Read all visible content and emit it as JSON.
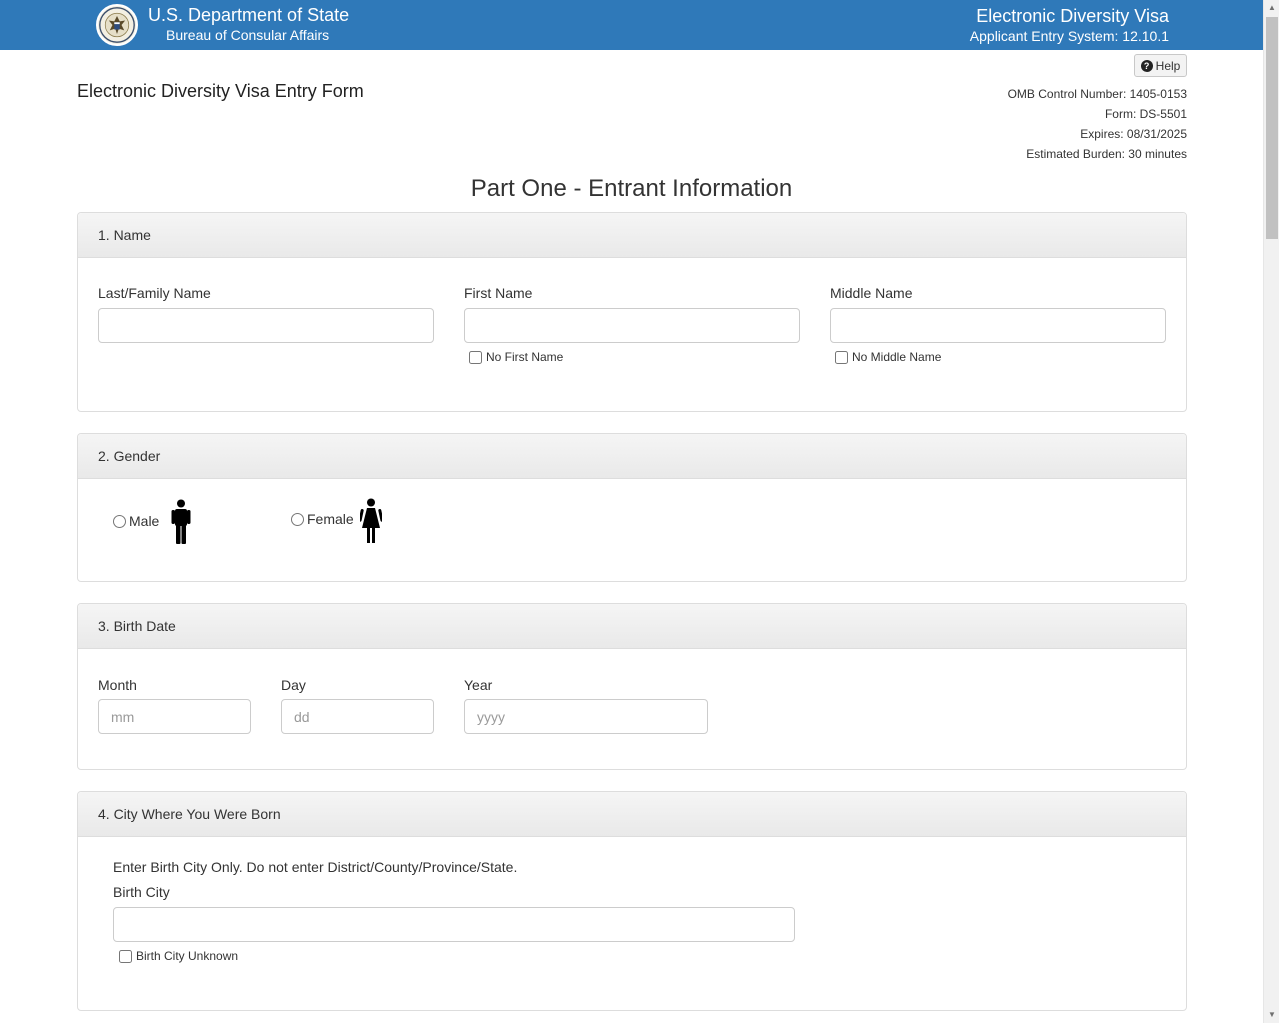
{
  "header": {
    "department": "U.S. Department of State",
    "bureau": "Bureau of Consular Affairs",
    "system_title": "Electronic Diversity Visa",
    "system_version": "Applicant Entry System: 12.10.1"
  },
  "help_label": "Help",
  "form_title": "Electronic Diversity Visa Entry Form",
  "meta": {
    "omb": "OMB Control Number: 1405-0153",
    "form": "Form: DS-5501",
    "expires": "Expires: 08/31/2025",
    "burden": "Estimated Burden: 30 minutes"
  },
  "part_title": "Part One - Entrant Information",
  "name_section": {
    "heading": "1. Name",
    "last_label": "Last/Family Name",
    "first_label": "First Name",
    "middle_label": "Middle Name",
    "last_value": "",
    "first_value": "",
    "middle_value": "",
    "no_first_label": "No First Name",
    "no_middle_label": "No Middle Name"
  },
  "gender_section": {
    "heading": "2. Gender",
    "male_label": "Male",
    "female_label": "Female",
    "male_icon": "male-figure-icon",
    "female_icon": "female-figure-icon"
  },
  "birth_date_section": {
    "heading": "3. Birth Date",
    "month_label": "Month",
    "day_label": "Day",
    "year_label": "Year",
    "month_placeholder": "mm",
    "day_placeholder": "dd",
    "year_placeholder": "yyyy"
  },
  "birth_city_section": {
    "heading": "4. City Where You Were Born",
    "instruction": "Enter Birth City Only. Do not enter District/County/Province/State.",
    "city_label": "Birth City",
    "city_value": "",
    "unknown_label": "Birth City Unknown"
  },
  "colors": {
    "header_bg": "#2f79b9",
    "panel_head_bg": "#eeeeee",
    "border": "#dddddd"
  }
}
